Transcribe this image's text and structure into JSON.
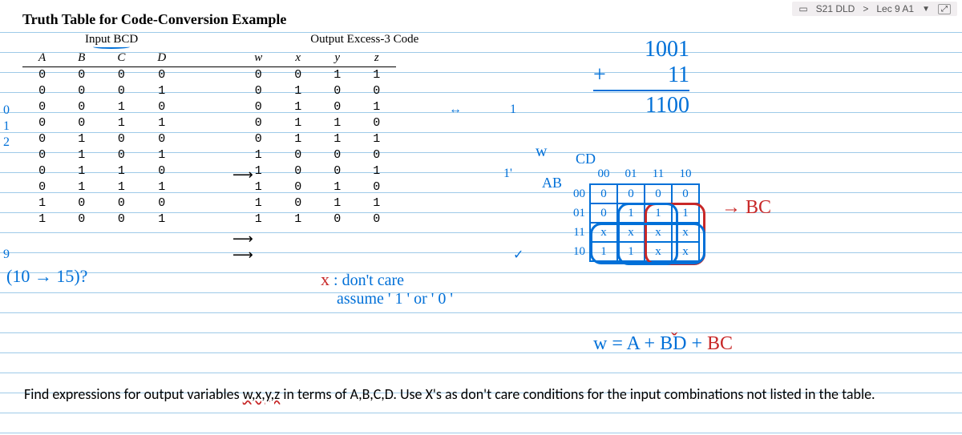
{
  "topbar": {
    "course": "S21 DLD",
    "sep": ">",
    "lec": "Lec 9 A1"
  },
  "title": "Truth Table for Code-Conversion Example",
  "headers": {
    "input_group": "Input BCD",
    "output_group": "Output Excess-3 Code",
    "cols": {
      "A": "A",
      "B": "B",
      "C": "C",
      "D": "D",
      "W": "w",
      "X": "x",
      "Y": "y",
      "Z": "z"
    }
  },
  "rows": [
    {
      "A": "0",
      "B": "0",
      "C": "0",
      "D": "0",
      "W": "0",
      "X": "0",
      "Y": "1",
      "Z": "1"
    },
    {
      "A": "0",
      "B": "0",
      "C": "0",
      "D": "1",
      "W": "0",
      "X": "1",
      "Y": "0",
      "Z": "0"
    },
    {
      "A": "0",
      "B": "0",
      "C": "1",
      "D": "0",
      "W": "0",
      "X": "1",
      "Y": "0",
      "Z": "1"
    },
    {
      "A": "0",
      "B": "0",
      "C": "1",
      "D": "1",
      "W": "0",
      "X": "1",
      "Y": "1",
      "Z": "0"
    },
    {
      "A": "0",
      "B": "1",
      "C": "0",
      "D": "0",
      "W": "0",
      "X": "1",
      "Y": "1",
      "Z": "1"
    },
    {
      "A": "0",
      "B": "1",
      "C": "0",
      "D": "1",
      "W": "1",
      "X": "0",
      "Y": "0",
      "Z": "0"
    },
    {
      "A": "0",
      "B": "1",
      "C": "1",
      "D": "0",
      "W": "1",
      "X": "0",
      "Y": "0",
      "Z": "1"
    },
    {
      "A": "0",
      "B": "1",
      "C": "1",
      "D": "1",
      "W": "1",
      "X": "0",
      "Y": "1",
      "Z": "0"
    },
    {
      "A": "1",
      "B": "0",
      "C": "0",
      "D": "0",
      "W": "1",
      "X": "0",
      "Y": "1",
      "Z": "1"
    },
    {
      "A": "1",
      "B": "0",
      "C": "0",
      "D": "1",
      "W": "1",
      "X": "1",
      "Y": "0",
      "Z": "0"
    }
  ],
  "margin_nums": [
    "0",
    "1",
    "2",
    "",
    "",
    "",
    "",
    "",
    "",
    "9"
  ],
  "ann": {
    "y_arrow": "↔",
    "tick_1": "1",
    "tick_1b": "1'",
    "check": "✓",
    "q1015": "(10 → 15)?",
    "dontcare_l1": "x :  don't care",
    "dontcare_l2": "assume ' 1 '  or  ' 0 '",
    "sum_a": "1001",
    "sum_plus": "+",
    "sum_b": "11",
    "sum_res": "1100",
    "w_lbl": "w",
    "cd": "CD",
    "ab": "AB",
    "col_00": "00",
    "col_01": "01",
    "col_11": "11",
    "col_10": "10",
    "r00": "00",
    "r01": "01",
    "r11": "11",
    "r10": "10",
    "k": [
      [
        "0",
        "0",
        "0",
        "0"
      ],
      [
        "0",
        "1",
        "1",
        "1"
      ],
      [
        "x",
        "x",
        "x",
        "x"
      ],
      [
        "1",
        "1",
        "x",
        "x"
      ]
    ],
    "bc_label": "→ BC",
    "w_eq": "w = A + BD + BC"
  },
  "footer": {
    "t1": "Find expressions for output variables ",
    "vars": "w,x,y,z",
    "t2": " in terms of A,B,C,D. Use X's as don't care conditions for the input combinations not listed in the table."
  }
}
